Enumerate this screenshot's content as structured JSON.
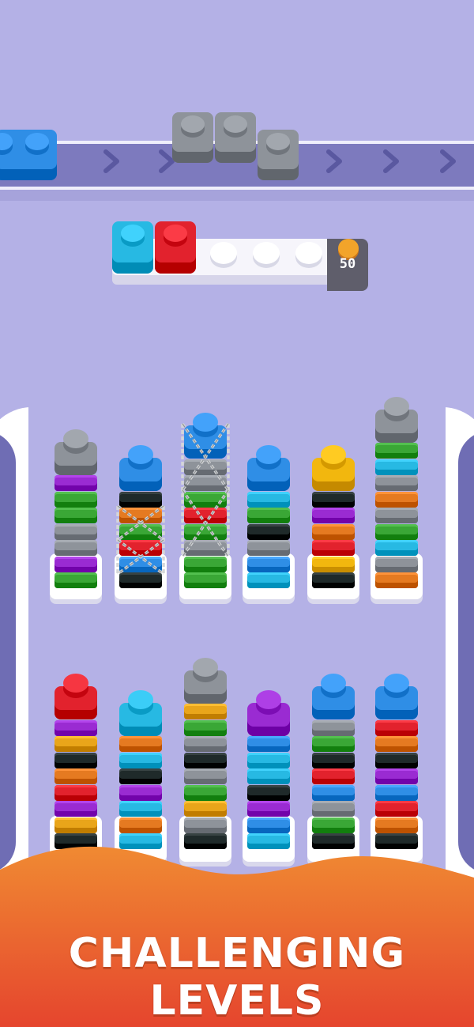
{
  "colors": {
    "gray": "#8e939a",
    "blue": "#2f8ee6",
    "cyan": "#27b9e3",
    "red": "#e2222d",
    "yellow": "#f2b70e",
    "purple": "#9a2bd2",
    "green": "#3aa736",
    "black": "#1f2a2a",
    "orange": "#e57a21",
    "gold": "#e9a51a"
  },
  "conveyor": {
    "label": "conveyor belt",
    "bricks": [
      "blue",
      "gray",
      "gray",
      "gray"
    ]
  },
  "collection_tray": {
    "filled_slots": [
      "cyan",
      "red"
    ],
    "empty_slots": 3,
    "coin_reward": "50"
  },
  "stacks": {
    "top_row": [
      {
        "top": "gray",
        "layers": [
          "purple",
          "green",
          "green",
          "gray",
          "gray",
          "purple",
          "green"
        ],
        "chained": false
      },
      {
        "top": "blue",
        "layers": [
          "black",
          "orange",
          "green",
          "red",
          "blue",
          "black"
        ],
        "chained": true
      },
      {
        "top": "blue",
        "layers": [
          "gray",
          "gray",
          "green",
          "red",
          "green",
          "gray",
          "green",
          "green"
        ],
        "chained": true
      },
      {
        "top": "blue",
        "layers": [
          "cyan",
          "green",
          "black",
          "gray",
          "blue",
          "cyan"
        ],
        "chained": false
      },
      {
        "top": "yellow",
        "layers": [
          "black",
          "purple",
          "orange",
          "red",
          "yellow",
          "black"
        ],
        "chained": false
      },
      {
        "top": "gray",
        "layers": [
          "green",
          "cyan",
          "gray",
          "orange",
          "gray",
          "green",
          "cyan",
          "gray",
          "orange"
        ],
        "chained": false
      }
    ],
    "bottom_row": [
      {
        "top": "red",
        "layers": [
          "purple",
          "gold",
          "black",
          "orange",
          "red",
          "purple",
          "gold",
          "black"
        ],
        "chained": false
      },
      {
        "top": "cyan",
        "layers": [
          "orange",
          "cyan",
          "black",
          "purple",
          "cyan",
          "orange",
          "cyan"
        ],
        "chained": false
      },
      {
        "top": "gray",
        "layers": [
          "gold",
          "green",
          "gray",
          "black",
          "gray",
          "green",
          "gold",
          "gray",
          "black"
        ],
        "chained": false
      },
      {
        "top": "purple",
        "layers": [
          "blue",
          "cyan",
          "cyan",
          "black",
          "purple",
          "blue",
          "cyan"
        ],
        "chained": false
      },
      {
        "top": "blue",
        "layers": [
          "gray",
          "green",
          "black",
          "red",
          "blue",
          "gray",
          "green",
          "black"
        ],
        "chained": false
      },
      {
        "top": "blue",
        "layers": [
          "red",
          "orange",
          "black",
          "purple",
          "blue",
          "red",
          "orange",
          "black"
        ],
        "chained": false
      }
    ]
  },
  "banner": {
    "text": "CHALLENGING LEVELS",
    "colors": [
      "#f08a32",
      "#e5452e"
    ]
  }
}
